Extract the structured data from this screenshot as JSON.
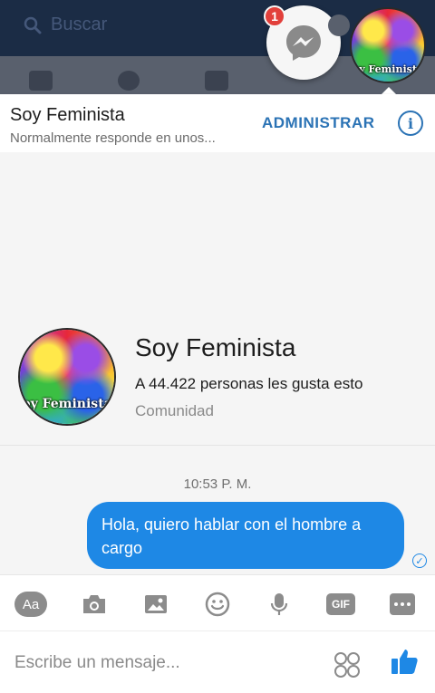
{
  "topbar": {
    "search_placeholder": "Buscar"
  },
  "chat_head": {
    "badge_count": "1"
  },
  "header": {
    "name": "Soy Feminista",
    "status": "Normalmente responde en unos...",
    "admin_label": "ADMINISTRAR",
    "info_glyph": "i"
  },
  "avatar": {
    "logo_text": "oy Feminista"
  },
  "profile": {
    "name": "Soy Feminista",
    "likes": "A 44.422 personas les gusta esto",
    "category": "Comunidad"
  },
  "conversation": {
    "timestamp": "10:53 P. M.",
    "messages": [
      {
        "text": "Hola, quiero hablar con el hombre a cargo",
        "from": "me"
      }
    ]
  },
  "toolbar": {
    "items": [
      "text-format-icon",
      "camera-icon",
      "image-icon",
      "emoji-icon",
      "microphone-icon",
      "gif-icon",
      "more-icon"
    ],
    "aa_label": "Aa",
    "gif_label": "GIF"
  },
  "composer": {
    "placeholder": "Escribe un mensaje..."
  },
  "colors": {
    "accent": "#1e88e5",
    "link": "#2b73b5",
    "topbar": "#1b2c45"
  }
}
